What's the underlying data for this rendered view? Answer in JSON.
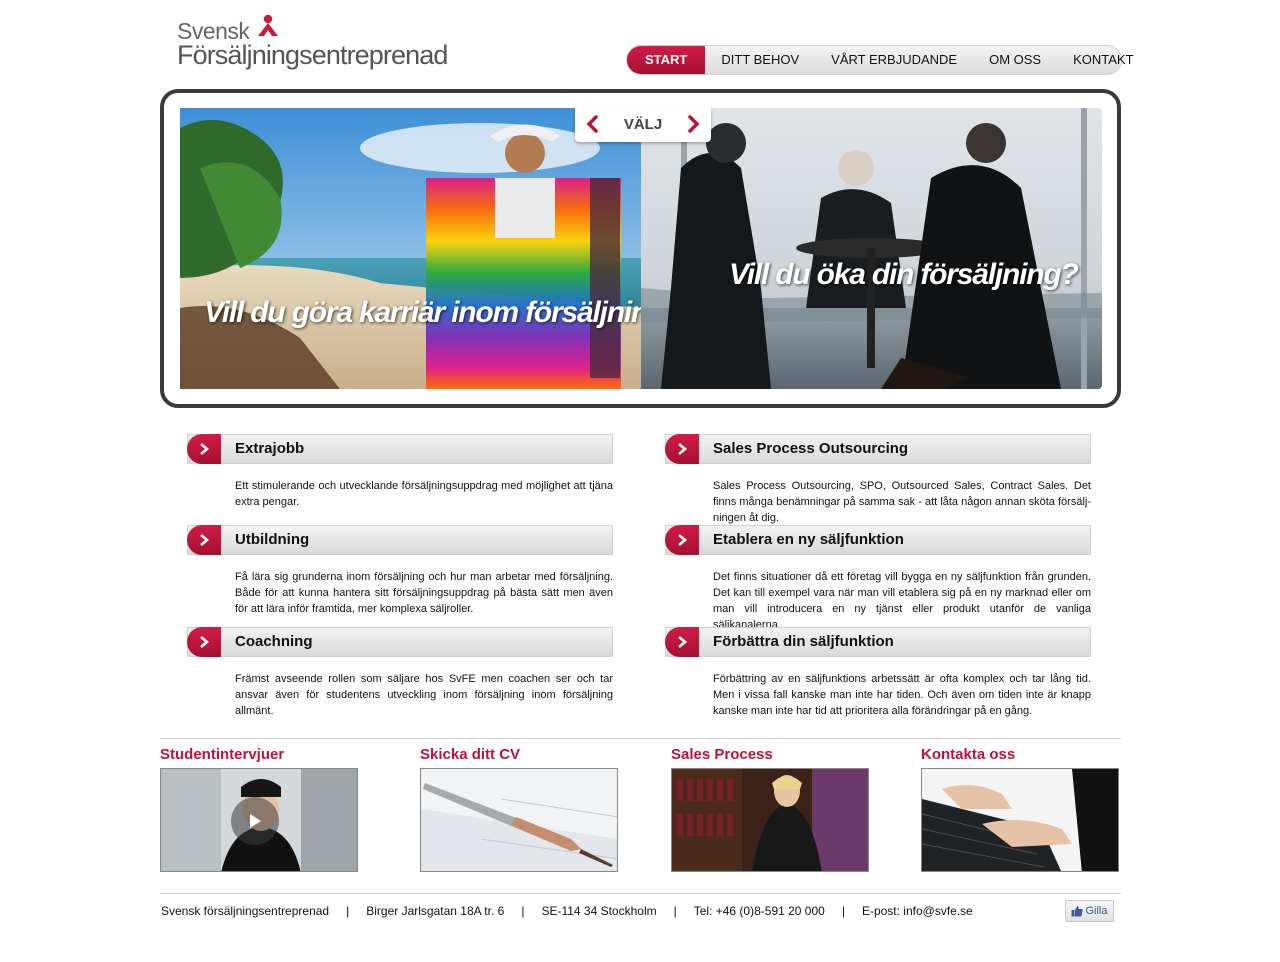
{
  "logo": {
    "line1": "Svensk",
    "line2": "Försäljningsentreprenad",
    "mark_icon": "person-logo-icon"
  },
  "nav": {
    "items": [
      {
        "label": "START",
        "active": true
      },
      {
        "label": "DITT BEHOV"
      },
      {
        "label": "VÅRT ERBJUDANDE"
      },
      {
        "label": "OM OSS"
      },
      {
        "label": "KONTAKT"
      }
    ]
  },
  "slider": {
    "selector_label": "VÄLJ",
    "left_caption": "Vill du göra karriär inom försäljning?",
    "right_caption": "Vill du öka din försäljning?"
  },
  "services": [
    {
      "title": "Extrajobb",
      "text": "Ett stimulerande och utvecklande försäljningsuppdrag med möjlighet att tjäna extra pengar."
    },
    {
      "title": "Utbildning",
      "text": "Få lära sig grunderna inom försäljning och hur man arbetar med försäljning. Både för att kunna hantera sitt försäljningsuppdrag på bästa sätt men även för att lära inför framtida, mer komplexa säljroller."
    },
    {
      "title": "Coachning",
      "text": "Främst avseende rollen som säljare hos SvFE men coachen ser och tar ansvar även för studentens utveckling inom försäljning inom försäljning allmänt."
    },
    {
      "title": "Sales Process Outsourcing",
      "text": "Sales Process Outsourcing, SPO, Outsourced Sales, Contract Sales. Det finns många benämningar på samma sak - att låta någon annan sköta försälj-ningen åt dig."
    },
    {
      "title": "Etablera en ny säljfunktion",
      "text": "Det finns situationer då ett företag vill bygga en ny säljfunktion från grunden. Det kan till exempel vara när man vill etablera sig på en ny marknad eller om man vill introducera en ny tjänst eller produkt utanför de vanliga säljkanalerna."
    },
    {
      "title": "Förbättra din säljfunktion",
      "text": "Förbättring av en säljfunktions arbetssätt är ofta komplex och tar lång tid. Men i vissa fall kanske man inte har tiden. Och även om tiden inte är knapp kanske man inte har tid att prioritera alla förändringar på en gång."
    }
  ],
  "boxes": [
    {
      "title": "Studentintervjuer"
    },
    {
      "title": "Skicka ditt CV"
    },
    {
      "title": "Sales Process"
    },
    {
      "title": "Kontakta oss"
    }
  ],
  "footer": {
    "company": "Svensk försäljningsentreprenad",
    "address": "Birger Jarlsgatan 18A tr. 6",
    "postal": "SE-114 34 Stockholm",
    "phone": "Tel: +46 (0)8-591 20 000",
    "email": "E-post: info@svfe.se",
    "separator": "|",
    "like_label": "Gilla"
  },
  "colors": {
    "accent": "#c0113a",
    "frame": "#3a3a3a"
  }
}
